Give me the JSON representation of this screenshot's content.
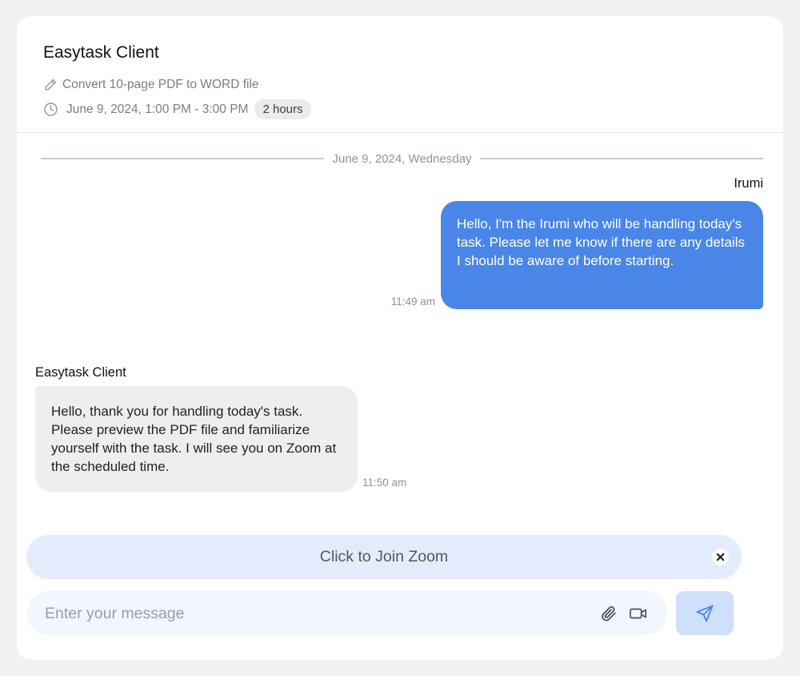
{
  "header": {
    "title": "Easytask Client",
    "task_description": "Convert 10-page PDF to WORD file",
    "schedule": "June 9, 2024, 1:00 PM - 3:00 PM",
    "duration": "2 hours"
  },
  "conversation": {
    "date_label": "June 9, 2024, Wednesday",
    "messages": [
      {
        "sender": "Irumi",
        "text": "Hello, I'm the Irumi who will be handling today's task. Please let me know if there are any details I should be aware of before starting.",
        "time": "11:49 am",
        "direction": "outgoing"
      },
      {
        "sender": "Easytask Client",
        "text": "Hello, thank you for handling today's task. Please preview the PDF file and familiarize yourself with the task. I will see you on Zoom at the scheduled time.",
        "time": "11:50 am",
        "direction": "incoming"
      }
    ]
  },
  "zoom_banner": {
    "label": "Click to Join Zoom",
    "close_icon": "close-icon"
  },
  "composer": {
    "placeholder": "Enter your message",
    "value": "",
    "attach_icon": "paperclip-icon",
    "video_icon": "video-camera-icon",
    "send_icon": "send-icon"
  },
  "colors": {
    "accent": "#4a86e8",
    "incoming_bubble": "#eeeeef",
    "zoom_banner_bg": "#e3ecfd",
    "composer_bg": "#f1f6ff",
    "send_button_bg": "#cfe0fb",
    "page_bg": "#f0f1f3"
  }
}
